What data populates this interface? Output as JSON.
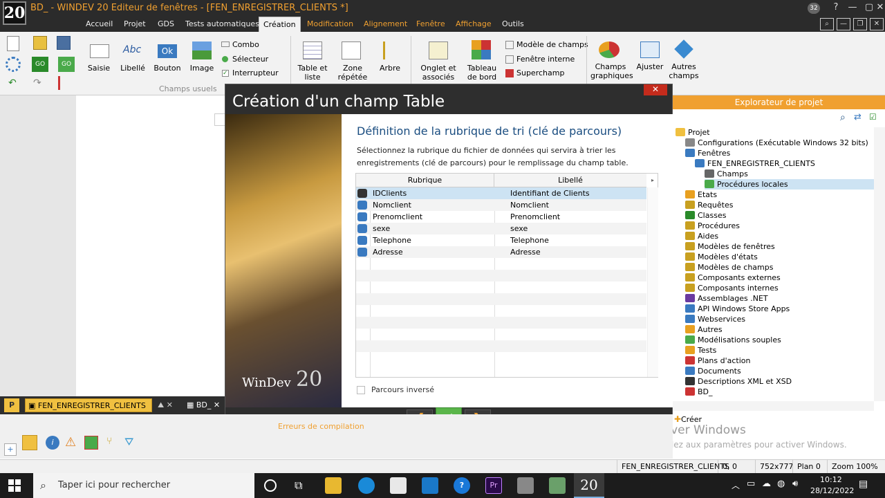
{
  "window": {
    "logo_text": "20",
    "title": "BD_ - WINDEV 20  Editeur de fenêtres - [FEN_ENREGISTRER_CLIENTS *]",
    "notif_count": "32"
  },
  "menu": [
    "Accueil",
    "Projet",
    "GDS",
    "Tests automatiques",
    "Création",
    "Modification",
    "Alignement",
    "Fenêtre",
    "Affichage",
    "Outils"
  ],
  "ribbon": {
    "saisie": "Saisie",
    "libelle": "Libellé",
    "libelle_sample": "Abc",
    "bouton": "Bouton",
    "bouton_sample": "Ok",
    "image": "Image",
    "combo": "Combo",
    "selecteur": "Sélecteur",
    "interrupteur": "Interrupteur",
    "group_champs_usuels": "Champs usuels",
    "table_liste": "Table et liste",
    "zone_repetee": "Zone répétée",
    "arbre": "Arbre",
    "onglet": "Onglet et associés",
    "tableau_bord": "Tableau de bord",
    "modele_champs": "Modèle de champs",
    "fenetre_interne": "Fenêtre interne",
    "superchamp": "Superchamp",
    "champs_graphiques": "Champs graphiques",
    "ajuster": "Ajuster",
    "autres_champs": "Autres champs"
  },
  "dialog": {
    "title": "Création d'un champ Table",
    "brand": "WinDev",
    "brand_num": "20",
    "heading": "Définition de la rubrique de tri (clé de parcours)",
    "description": "Sélectionnez la rubrique du fichier de données qui servira à trier les enregistrements (clé de parcours) pour le remplissage du champ table.",
    "col_rubrique": "Rubrique",
    "col_libelle": "Libellé",
    "rows": [
      {
        "rubrique": "IDClients",
        "libelle": "Identifiant de Clients"
      },
      {
        "rubrique": "Nomclient",
        "libelle": "Nomclient"
      },
      {
        "rubrique": "Prenomclient",
        "libelle": "Prenomclient"
      },
      {
        "rubrique": "sexe",
        "libelle": "sexe"
      },
      {
        "rubrique": "Telephone",
        "libelle": "Telephone"
      },
      {
        "rubrique": "Adresse",
        "libelle": "Adresse"
      }
    ],
    "checkbox_label": "Parcours inversé"
  },
  "explorer": {
    "title": "Explorateur de projet",
    "items": [
      "Projet",
      "Configurations (Exécutable Windows 32 bits)",
      "Fenêtres",
      "FEN_ENREGISTRER_CLIENTS",
      "Champs",
      "Procédures locales",
      "Etats",
      "Requêtes",
      "Classes",
      "Procédures",
      "Aides",
      "Modèles de fenêtres",
      "Modèles d'états",
      "Modèles de champs",
      "Composants externes",
      "Composants internes",
      "Assemblages .NET",
      "API Windows Store Apps",
      "Webservices",
      "Autres",
      "Modélisations souples",
      "Tests",
      "Plans d'action",
      "Documents",
      "Descriptions XML et XSD",
      "BD_"
    ],
    "create": "Créer"
  },
  "tabs": {
    "active": "FEN_ENREGISTRER_CLIENTS",
    "second": "BD_",
    "errors": "Erreurs de compilation"
  },
  "status": {
    "window": "FEN_ENREGISTRER_CLIENTS",
    "pos": "0, 0",
    "size": "752x777",
    "plan": "Plan 0",
    "zoom": "Zoom 100%"
  },
  "watermark": {
    "line1": "Activer Windows",
    "line2": "Accédez aux paramètres pour activer Windows."
  },
  "taskbar": {
    "search": "Taper ici pour rechercher",
    "time": "10:12",
    "date": "28/12/2022"
  }
}
